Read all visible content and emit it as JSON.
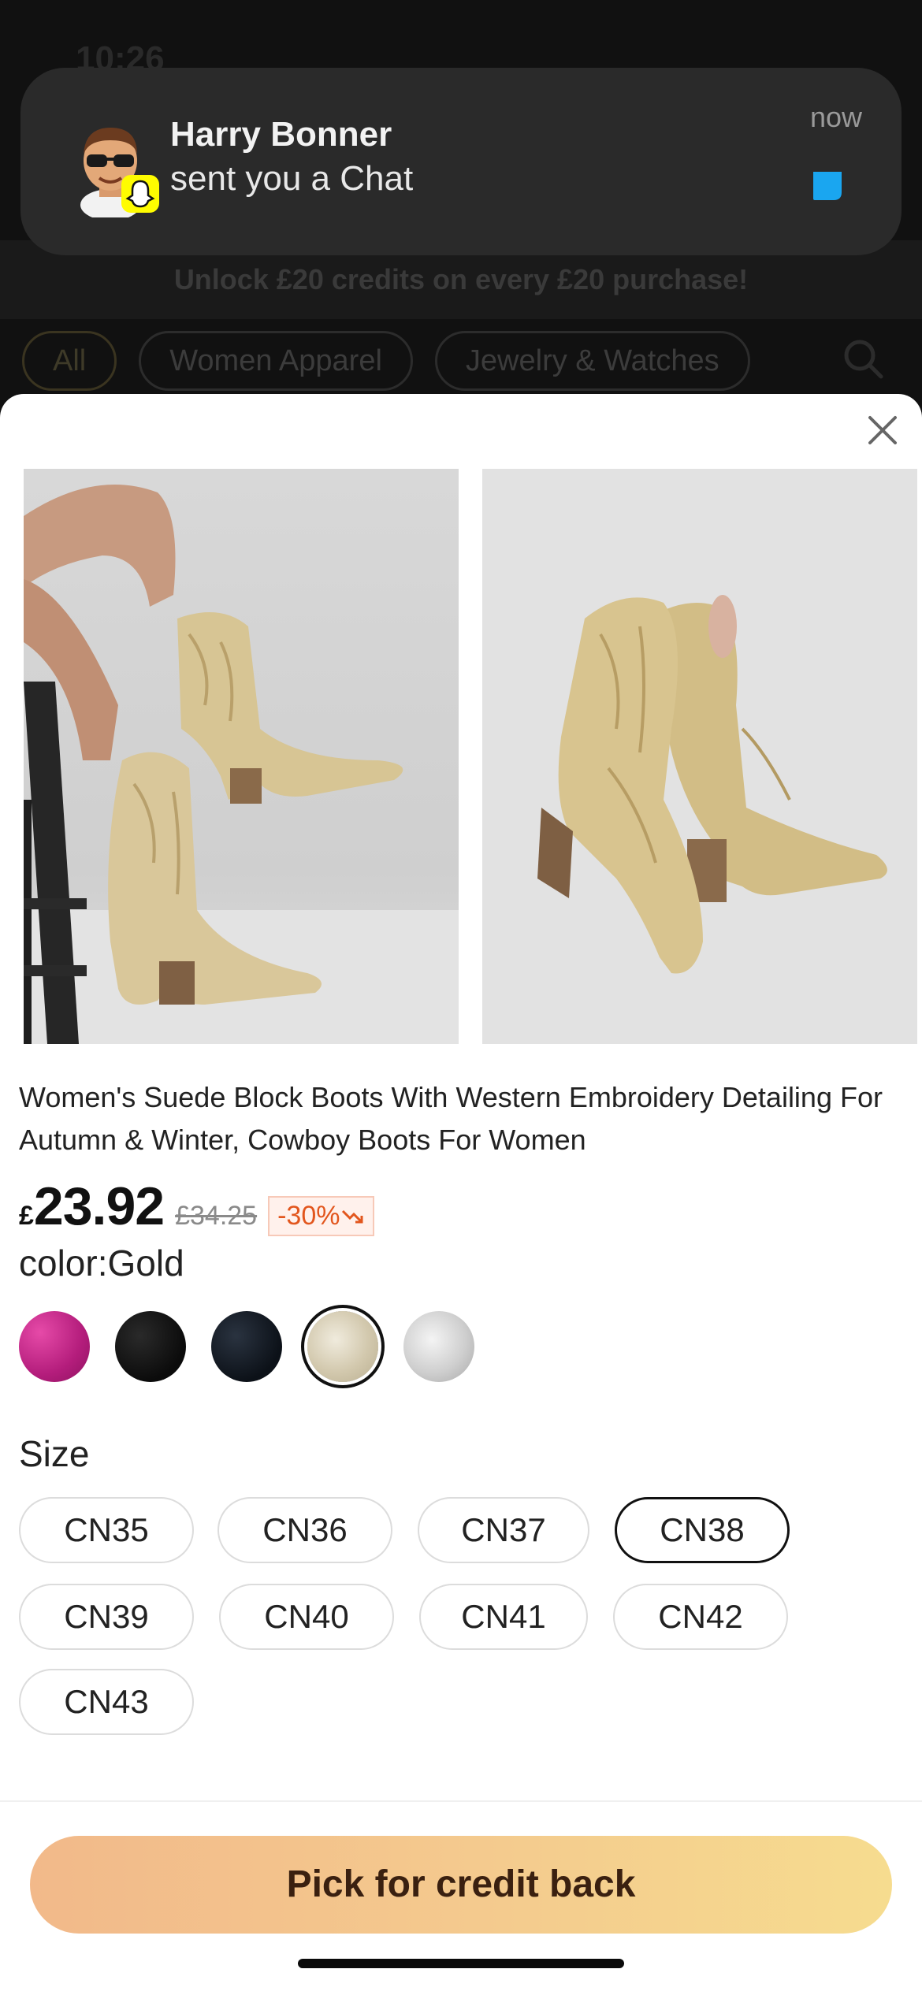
{
  "background": {
    "status_time": "10:26",
    "banner_text": "Unlock £20 credits on every £20 purchase!",
    "chips": [
      "All",
      "Women Apparel",
      "Jewelry & Watches"
    ]
  },
  "notification": {
    "app_icon": "snapchat-icon",
    "title": "Harry Bonner",
    "body": "sent you a Chat",
    "time": "now"
  },
  "product": {
    "title": "Women's Suede Block Boots With Western Embroidery Detailing For Autumn & Winter, Cowboy Boots For Women",
    "currency": "£",
    "price": "23.92",
    "old_price": "£34.25",
    "discount": "-30%",
    "color_label": "color:Gold",
    "colors": [
      {
        "name": "Pink",
        "hex": "#c4288e"
      },
      {
        "name": "Black",
        "hex": "#111111"
      },
      {
        "name": "Navy Black",
        "hex": "#131820"
      },
      {
        "name": "Gold",
        "hex": "#d9d1bd",
        "selected": true
      },
      {
        "name": "Silver",
        "hex": "#c9c9c9"
      }
    ],
    "size_label": "Size",
    "sizes": [
      "CN35",
      "CN36",
      "CN37",
      "CN38",
      "CN39",
      "CN40",
      "CN41",
      "CN42",
      "CN43"
    ],
    "selected_size": "CN38"
  },
  "cta_label": "Pick for credit back",
  "colors": {
    "discount": "#e2561d",
    "cta_start": "#f2b98a",
    "cta_end": "#f6dc8f"
  }
}
